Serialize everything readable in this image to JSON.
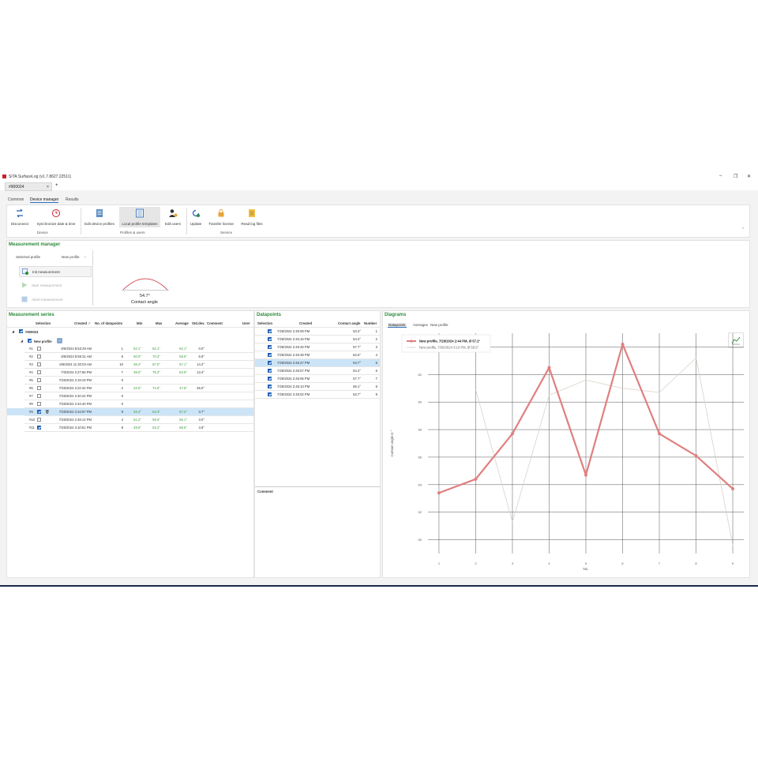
{
  "window": {
    "title": "SITA SurfaceLog (v1.7.8627.22511)",
    "doc_tab": "#900024",
    "doc_tab_close": "×",
    "new_tab": "+",
    "minimize": "–",
    "restore": "❐",
    "close": "✕"
  },
  "ribbon_tabs": [
    "Common",
    "Device manager",
    "Results"
  ],
  "ribbon": {
    "buttons": [
      {
        "label": "Disconnect",
        "icon": "disconnect-icon"
      },
      {
        "label": "Synchronize date & time",
        "icon": "clock-icon"
      },
      {
        "label": "Edit device profiles",
        "icon": "device-profiles-icon"
      },
      {
        "label": "Local profile templates",
        "icon": "profile-templates-icon"
      },
      {
        "label": "Edit users",
        "icon": "users-icon"
      },
      {
        "label": "Update",
        "icon": "update-icon"
      },
      {
        "label": "Transfer license",
        "icon": "license-icon"
      },
      {
        "label": "Read log files",
        "icon": "log-files-icon"
      }
    ],
    "groups": [
      "Device",
      "Profiles & users",
      "Service"
    ],
    "collapse": "⌃"
  },
  "measurement_manager": {
    "title": "Measurement manager",
    "selected_profile_label": "Selected profile",
    "selected_profile_value": "New profile",
    "btn_init": "Init measurement",
    "btn_start": "Start measurement",
    "btn_abort": "Abort measurement",
    "angle_value": "54.7°",
    "angle_caption": "Contact angle"
  },
  "series": {
    "title": "Measurement series",
    "columns": [
      "Selection",
      "Created",
      "No. of datapoints",
      "Min",
      "Max",
      "Average",
      "Std.dev.",
      "Comment",
      "User"
    ],
    "root": "#900024",
    "profile": "New profile",
    "rows": [
      {
        "id": "#1",
        "checked": false,
        "created": "6/6/2024 8:53:29 AM",
        "n": "1",
        "min": "62.1°",
        "max": "62.1°",
        "avg": "62.1°",
        "sd": "0.0°"
      },
      {
        "id": "#2",
        "checked": false,
        "created": "6/6/2024 8:56:31 AM",
        "n": "6",
        "min": "50.0°",
        "max": "70.3°",
        "avg": "58.6°",
        "sd": "6.8°"
      },
      {
        "id": "#3",
        "checked": false,
        "created": "6/6/2024 11:30:03 AM",
        "n": "10",
        "min": "36.4°",
        "max": "87.0°",
        "avg": "57.1°",
        "sd": "14.2°"
      },
      {
        "id": "#4",
        "checked": false,
        "created": "7/3/2024 2:27:56 PM",
        "n": "7",
        "min": "39.0°",
        "max": "75.3°",
        "avg": "63.9°",
        "sd": "13.4°"
      },
      {
        "id": "#5",
        "checked": false,
        "created": "7/26/2024 2:19:19 PM",
        "n": "0",
        "min": "",
        "max": "",
        "avg": "",
        "sd": ""
      },
      {
        "id": "#6",
        "checked": false,
        "created": "7/26/2024 2:22:34 PM",
        "n": "2",
        "min": "22.6°",
        "max": "72.6°",
        "avg": "47.6°",
        "sd": "25.0°"
      },
      {
        "id": "#7",
        "checked": false,
        "created": "7/26/2024 2:40:24 PM",
        "n": "0",
        "min": "",
        "max": "",
        "avg": "",
        "sd": ""
      },
      {
        "id": "#8",
        "checked": false,
        "created": "7/26/2024 2:44:40 PM",
        "n": "0",
        "min": "",
        "max": "",
        "avg": "",
        "sd": ""
      },
      {
        "id": "#9",
        "checked": true,
        "created": "7/26/2024 2:44:57 PM",
        "n": "9",
        "min": "53.4°",
        "max": "64.3°",
        "avg": "57.2°",
        "sd": "3.7°"
      },
      {
        "id": "#10",
        "checked": false,
        "created": "7/26/2024 2:49:14 PM",
        "n": "4",
        "min": "51.2°",
        "max": "59.6°",
        "avg": "55.1°",
        "sd": "3.0°"
      },
      {
        "id": "#11",
        "checked": true,
        "created": "7/26/2024 3:10:51 PM",
        "n": "8",
        "min": "49.6°",
        "max": "63.2°",
        "avg": "58.5°",
        "sd": "4.8°"
      }
    ]
  },
  "datapoints": {
    "title": "Datapoints",
    "columns": [
      "Selection",
      "Created",
      "Contact angle",
      "Number"
    ],
    "rows": [
      {
        "created": "7/26/2024 2:45:09 PM",
        "angle": "53.4°",
        "num": "1"
      },
      {
        "created": "7/26/2024 2:45:16 PM",
        "angle": "54.4°",
        "num": "2"
      },
      {
        "created": "7/26/2024 2:45:26 PM",
        "angle": "57.7°",
        "num": "3"
      },
      {
        "created": "7/26/2024 2:45:39 PM",
        "angle": "62.5°",
        "num": "4"
      },
      {
        "created": "7/26/2024 2:45:47 PM",
        "angle": "54.7°",
        "num": "5"
      },
      {
        "created": "7/26/2024 2:45:57 PM",
        "angle": "64.2°",
        "num": "6"
      },
      {
        "created": "7/26/2024 2:46:06 PM",
        "angle": "57.7°",
        "num": "7"
      },
      {
        "created": "7/26/2024 2:46:13 PM",
        "angle": "56.1°",
        "num": "8"
      },
      {
        "created": "7/26/2024 2:46:02 PM",
        "angle": "53.7°",
        "num": "9"
      }
    ],
    "comment_label": "Comment"
  },
  "diagrams": {
    "title": "Diagrams",
    "tabs": [
      "Datapoints",
      "Averages",
      "New profile"
    ]
  },
  "chart_data": {
    "type": "line",
    "x": [
      1,
      2,
      3,
      4,
      5,
      6,
      7,
      8,
      9
    ],
    "xlabel": "No.",
    "ylabel": "Contact angle in °",
    "ylim": [
      49,
      65
    ],
    "yticks": [
      50,
      52,
      54,
      56,
      58,
      60,
      62,
      64
    ],
    "grid": true,
    "legend_position": "top-left",
    "series": [
      {
        "name": "New profile, 7/26/2024 2:44 PM, Ø 57.2°",
        "color": "#e07f7f",
        "values": [
          53.4,
          54.4,
          57.7,
          62.5,
          54.7,
          64.2,
          57.7,
          56.1,
          53.7
        ]
      },
      {
        "name": "New profile, 7/26/2024 3:10 PM, Ø 58.5°",
        "color": "#d8d2c8",
        "values": [
          null,
          60.9,
          51.3,
          60.5,
          61.6,
          61.0,
          60.7,
          63.2,
          49.6
        ]
      }
    ]
  }
}
